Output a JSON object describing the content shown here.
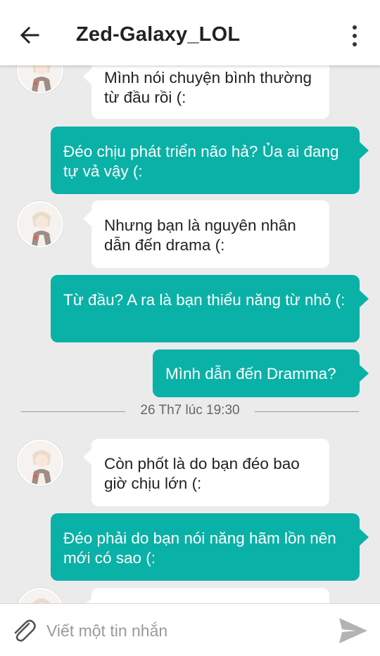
{
  "header": {
    "title": "Zed-Galaxy_LOL"
  },
  "messages": [
    {
      "direction": "in",
      "text": "Mình nói chuyện bình thường từ đầu rồi (:"
    },
    {
      "direction": "out",
      "text": "Đéo chịu phát triển não hả? Ủa ai đang tự vả vậy (:"
    },
    {
      "direction": "in",
      "text": "Nhưng bạn là nguyên nhân dẫn đến drama (:"
    },
    {
      "direction": "out",
      "text": "Từ đầu? A ra là bạn thiểu năng từ nhỏ (:"
    },
    {
      "direction": "out",
      "text": "Mình dẫn đến Dramma?"
    },
    {
      "direction": "in",
      "text": "Còn phốt là do bạn đéo bao giờ chịu lớn (:"
    },
    {
      "direction": "out",
      "text": "Đéo phải do bạn nói năng hãm lồn nên mới có sao (:"
    }
  ],
  "date_separator": "26 Th7 lúc 19:30",
  "composer": {
    "placeholder": "Viết một tin nhắn"
  },
  "colors": {
    "outgoing_bubble": "#0ab1a6",
    "incoming_bubble": "#ffffff",
    "chat_background": "#ebebeb"
  },
  "icons": {
    "back": "arrow-left-icon",
    "more": "more-vertical-icon",
    "attach": "paperclip-icon",
    "send": "send-icon"
  }
}
